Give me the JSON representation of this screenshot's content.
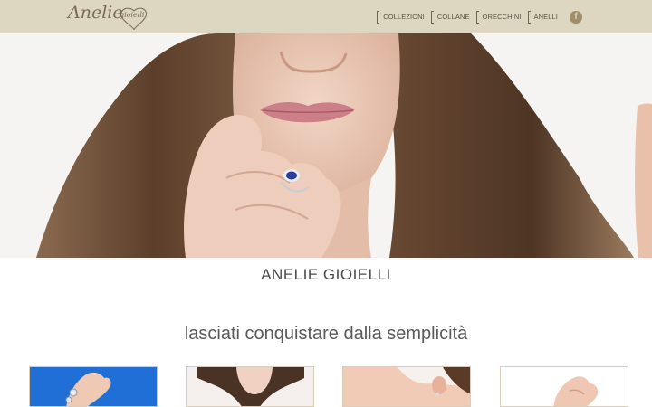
{
  "header": {
    "logo_text": "Anelie",
    "logo_sub": "gioielli",
    "nav": [
      {
        "label": "COLLEZIONI"
      },
      {
        "label": "COLLANE"
      },
      {
        "label": "ORECCHINI"
      },
      {
        "label": "ANELLI"
      }
    ],
    "facebook_icon": "facebook-icon",
    "facebook_glyph": "f"
  },
  "hero": {
    "image": "woman-wearing-sapphire-ring"
  },
  "main": {
    "brand_title": "ANELIE GIOIELLI",
    "tagline": "lasciati conquistare dalla semplicità"
  },
  "thumbnails": [
    {
      "image": "ring-on-hand-blue-background"
    },
    {
      "image": "necklace-woman-neck"
    },
    {
      "image": "earring-woman-ear"
    },
    {
      "image": "ring-on-hand-white-background"
    }
  ],
  "colors": {
    "header_bg": "#ddd6c0",
    "accent": "#a18c69",
    "text": "#5a5a5a"
  }
}
